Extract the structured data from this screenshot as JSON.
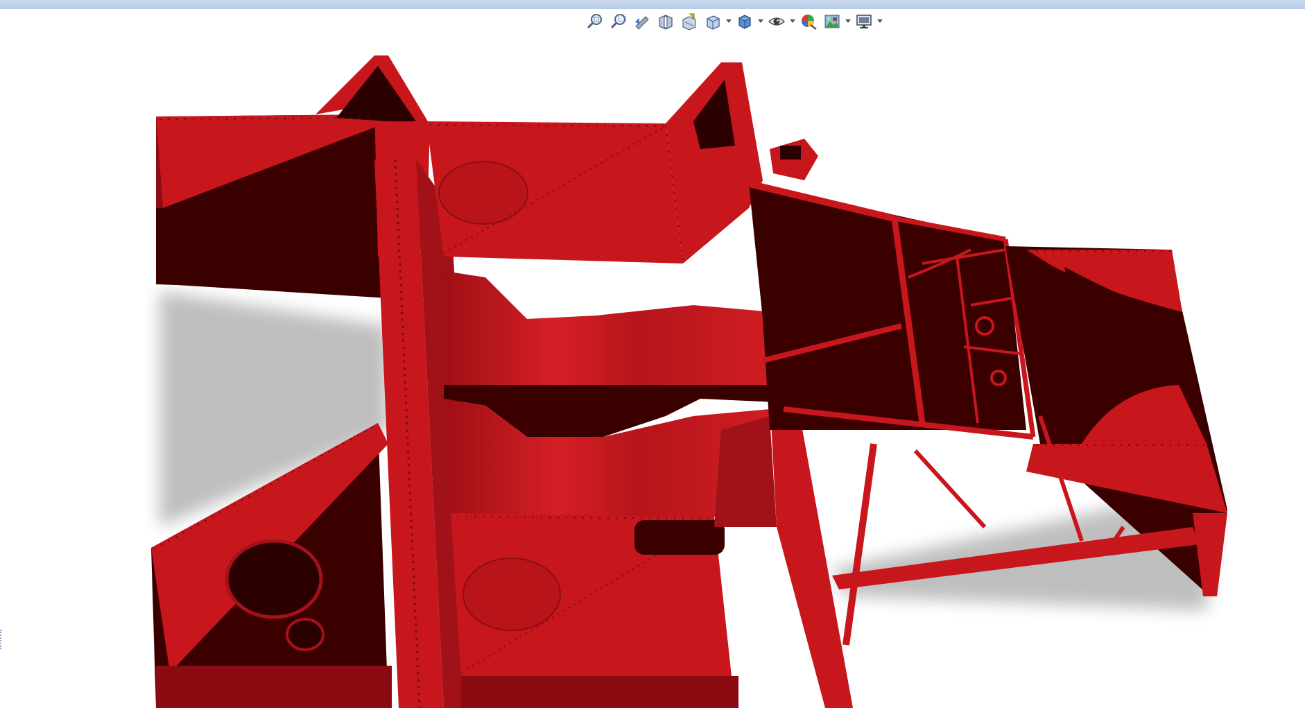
{
  "window": {
    "title_bar_color": "#bcd0ea"
  },
  "view_toolbar": {
    "buttons": [
      {
        "icon": "zoom-to-fit-icon",
        "has_dropdown": false
      },
      {
        "icon": "zoom-to-area-icon",
        "has_dropdown": false
      },
      {
        "icon": "previous-view-icon",
        "has_dropdown": false
      },
      {
        "icon": "section-view-icon",
        "has_dropdown": false
      },
      {
        "icon": "dynamic-annotation-view-icon",
        "has_dropdown": false
      },
      {
        "icon": "view-orientation-icon",
        "has_dropdown": true
      },
      {
        "icon": "display-style-icon",
        "has_dropdown": true
      },
      {
        "icon": "hide-show-items-icon",
        "has_dropdown": true
      },
      {
        "icon": "edit-appearance-icon",
        "has_dropdown": false
      },
      {
        "icon": "apply-scene-icon",
        "has_dropdown": true
      },
      {
        "icon": "view-settings-icon",
        "has_dropdown": true
      }
    ]
  },
  "model": {
    "part_color": "#c8161d",
    "shadow_color": "#3a0000",
    "description_icon": "race-car-chassis-3d-model"
  }
}
